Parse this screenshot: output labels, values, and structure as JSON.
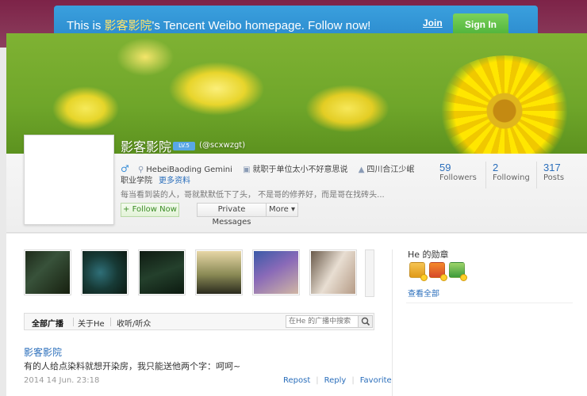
{
  "banner": {
    "prefix": "This is ",
    "name": "影客影院",
    "suffix": "'s Tencent Weibo homepage. Follow now!",
    "join_label": "Join",
    "signin_label": "Sign In"
  },
  "profile": {
    "display_name": "影客影院",
    "level_badge": "LV.5",
    "handle": "(@scxwzgt)",
    "gender_icon": "male-icon",
    "location": "HebeiBaoding Gemini",
    "job": "就职于单位太小不好意思说",
    "school_1": "四川合江少岷",
    "school_2": "职业学院",
    "more_info_label": "更多资料",
    "bio": "每当看到装的人，哥就默默低下了头， 不是哥的修养好，而是哥在找砖头...",
    "follow_label": "+ Follow Now",
    "pm_label": "Private Messages",
    "more_label": "More ▾",
    "stats": [
      {
        "value": "59",
        "label": "Followers"
      },
      {
        "value": "2",
        "label": "Following"
      },
      {
        "value": "317",
        "label": "Posts"
      }
    ]
  },
  "feed": {
    "tabs": [
      "全部广播",
      "关于He",
      "收听/听众"
    ],
    "search_placeholder": "在He 的广播中搜索",
    "post": {
      "author": "影客影院",
      "text": "有的人给点染料就想开染房，我只能送他两个字：呵呵~",
      "time": "2014 14 Jun. 23:18",
      "actions": [
        "Repost",
        "Reply",
        "Favorite"
      ]
    }
  },
  "sidebar": {
    "badges_title": "He 的勋章",
    "view_all": "查看全部"
  },
  "colors": {
    "banner_bg": "#2b89cc",
    "link": "#2a6ebb",
    "signin_bg": "#4fb23a"
  }
}
